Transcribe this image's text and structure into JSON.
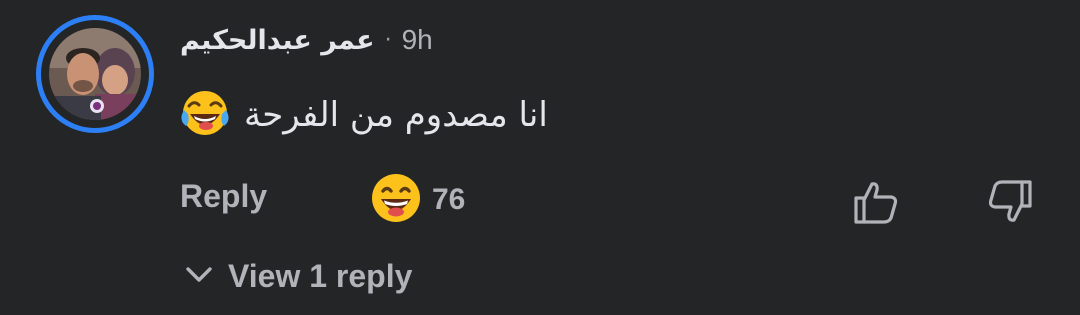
{
  "comment": {
    "author": "عمر عبدالحكيم",
    "separator": "·",
    "time": "9h",
    "text": "انا مصدوم من الفرحة",
    "text_emoji": "face-with-tears-of-joy",
    "avatar_ring_color": "#2d7ff5"
  },
  "actions": {
    "reply_label": "Reply",
    "reaction_emoji": "grinning-face",
    "reaction_count": "76",
    "like_icon": "thumbs-up-icon",
    "dislike_icon": "thumbs-down-icon"
  },
  "replies": {
    "view_label": "View 1 reply",
    "toggle_icon": "chevron-down-icon"
  },
  "colors": {
    "background": "#242526",
    "primary_text": "#e4e6eb",
    "secondary_text": "#b0b3b8",
    "accent": "#2d7ff5"
  }
}
